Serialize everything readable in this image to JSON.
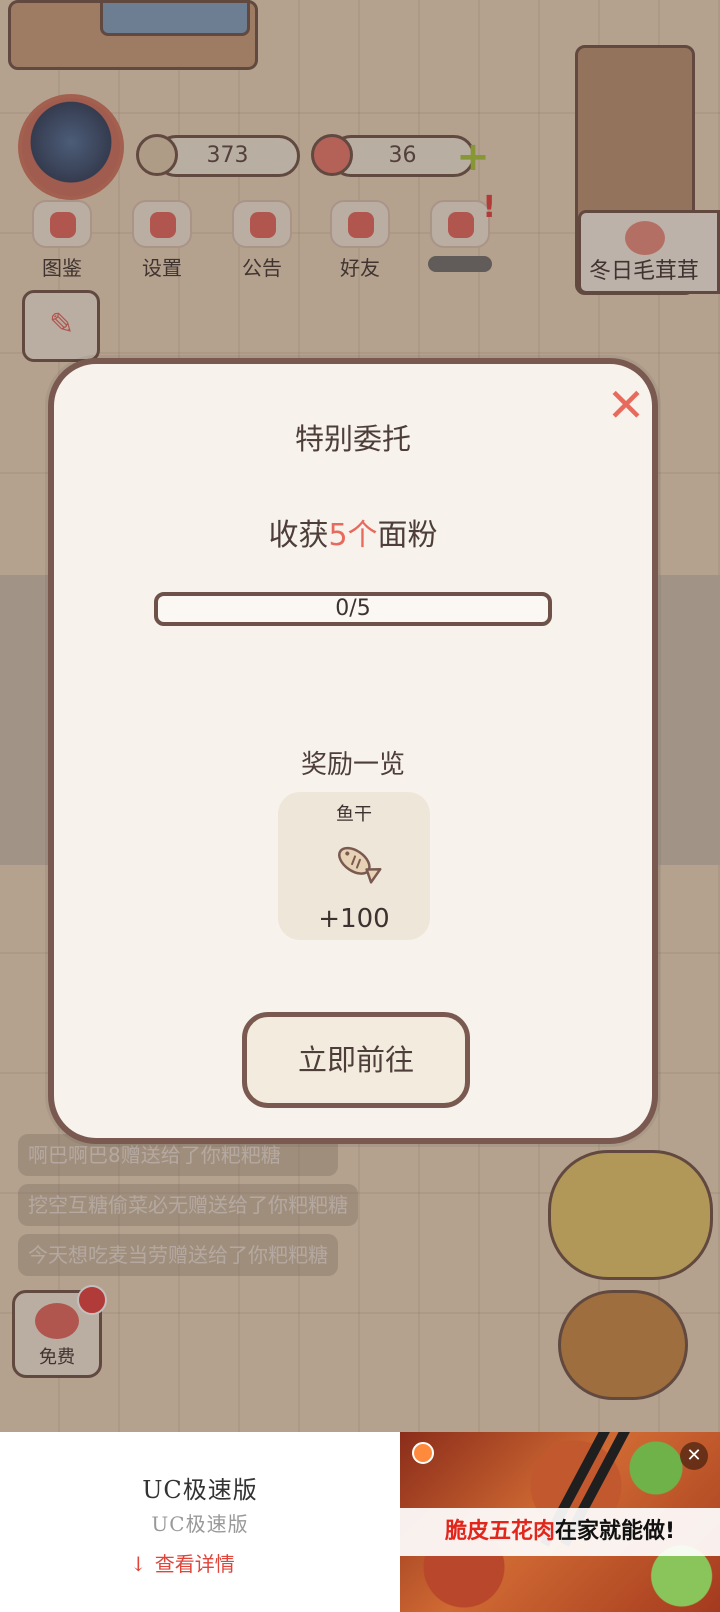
{
  "hud": {
    "fish_count": "373",
    "heart_count": "36",
    "plus_symbol": "+"
  },
  "menu": {
    "items": [
      {
        "label": "图鉴",
        "icon": "cat-book-icon"
      },
      {
        "label": "设置",
        "icon": "gear-icon"
      },
      {
        "label": "公告",
        "icon": "gift-icon"
      },
      {
        "label": "好友",
        "icon": "friends-icon"
      },
      {
        "label": "",
        "icon": "heart-broken-icon"
      }
    ],
    "notification_mark": "!"
  },
  "event_banner": {
    "label": "冬日毛茸茸"
  },
  "chat": {
    "messages": [
      "啊巴啊巴8赠送给了你粑粑糖",
      "挖空互糖偷菜必无赠送给了你粑粑糖",
      "今天想吃麦当劳赠送给了你粑粑糖"
    ]
  },
  "free_button": {
    "label": "免费"
  },
  "modal": {
    "title": "特别委托",
    "quest_prefix": "收获",
    "quest_highlight": "5个",
    "quest_suffix": "面粉",
    "progress_text": "0/5",
    "progress_fraction": 0,
    "rewards_title": "奖励一览",
    "reward": {
      "name": "鱼干",
      "amount": "+100",
      "icon": "dried-fish-icon"
    },
    "go_button": "立即前往",
    "close_symbol": "✕"
  },
  "ad": {
    "app_name": "UC极速版",
    "app_sub": "UC极速版",
    "detail_link": "查看详情",
    "detail_arrow": "↓",
    "caption_red": "脆皮五花肉",
    "caption_black": "在家就能做!",
    "close_symbol": "✕"
  },
  "colors": {
    "accent_red": "#e86a5c",
    "border_brown": "#7a5a50",
    "modal_bg": "#f7f2ec"
  }
}
